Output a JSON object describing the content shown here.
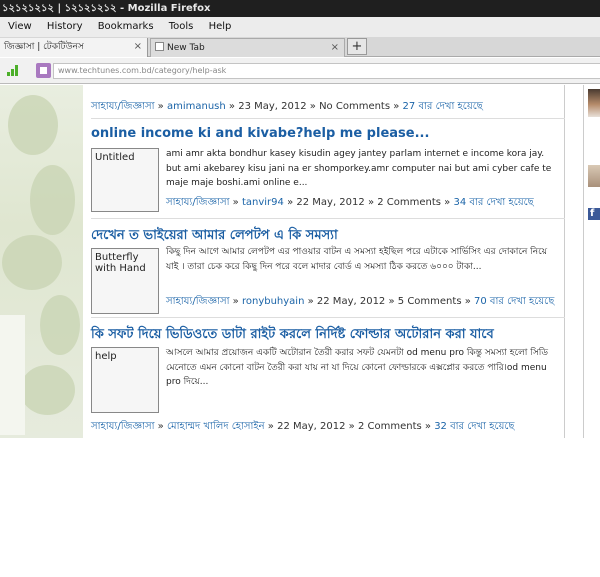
{
  "window": {
    "title": "১২১২১২১২ | ১২১২১২১২ - Mozilla Firefox"
  },
  "menu": [
    "View",
    "History",
    "Bookmarks",
    "Tools",
    "Help"
  ],
  "tabs": [
    {
      "label": "জিজ্ঞাসা | টেকটিউনস",
      "active": true
    },
    {
      "label": "New Tab",
      "active": false
    }
  ],
  "new_tab_label": "+",
  "close_glyph": "×",
  "url": "www.techtunes.com.bd/category/help-ask",
  "sidebar": {
    "fb_label": "f"
  },
  "top_meta": {
    "category": "সাহায্য/জিজ্ঞাসা",
    "author": "amimanush",
    "date": "23 May, 2012",
    "comments": "No Comments",
    "views": "27 বার দেখা হয়েছে"
  },
  "posts": [
    {
      "title": "online income ki and kivabe?help me please...",
      "thumb": "Untitled",
      "excerpt": "ami amr akta bondhur kasey kisudin agey jantey parlam internet e income kora jay. but ami akebarey kisu jani na er shomporkey.amr computer nai but ami cyber cafe te maje maje boshi.ami online e...",
      "category": "সাহায্য/জিজ্ঞাসা",
      "author": "tanvir94",
      "date": "22 May, 2012",
      "comments": "2 Comments",
      "views": "34 বার দেখা হয়েছে"
    },
    {
      "title": "দেখেন ত ভাইয়েরা আমার লেপটপ এ কি সমস্যা",
      "thumb": "Butterfly with Hand",
      "excerpt": "কিছু দিন আগে আমার লেপটপ এর পাওয়ার বাটন এ সমস্যা হইছিল পরে এটাকে সার্ভিসিং এর দোকানে নিয়ে যাই । তারা চেক করে কিছু দিন পরে বলে মাদার বোর্ড এ সমস্যা ঠিক করতে ৬০০০ টাকা...",
      "category": "সাহায্য/জিজ্ঞাসা",
      "author": "ronybuhyain",
      "date": "22 May, 2012",
      "comments": "5 Comments",
      "views": "70 বার দেখা হয়েছে"
    },
    {
      "title": "কি সফট দিয়ে ভিডিওতে ডাটা রাইট করলে নির্দিষ্ট ফোল্ডার অটোরান করা যাবে",
      "thumb": "help",
      "excerpt": "আসলে আমার প্রয়োজন একটি অটোরান তৈরী করার সফট যেমনটা od menu pro কিন্তু সমস্যা হলো সিডি মেনোতে এমন কোনো বাটন তৈরী করা যায় না যা দিয়ে কোনো ফোল্ডারকে এক্সপ্লোর করতে পারি।od menu pro দিয়ে...",
      "category": "সাহায্য/জিজ্ঞাসা",
      "author": "মোহাম্মদ খালিদ হোসাইন",
      "date": "22 May, 2012",
      "comments": "2 Comments",
      "views": "32 বার দেখা হয়েছে"
    }
  ]
}
